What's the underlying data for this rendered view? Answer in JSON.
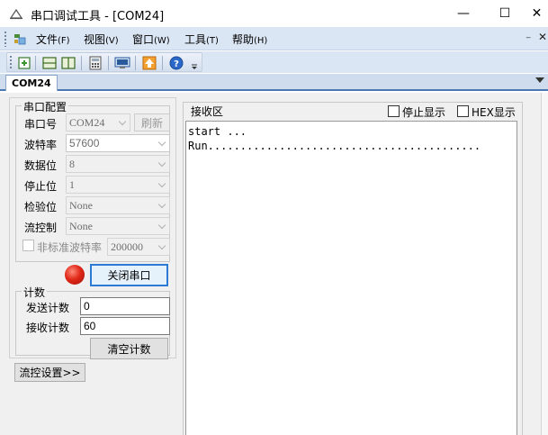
{
  "window": {
    "title": "串口调试工具 - [COM24]",
    "minimize_glyph": "—",
    "maximize_glyph": "☐",
    "close_glyph": "✕"
  },
  "menubar": {
    "items": [
      {
        "label": "文件",
        "accel": "(F)"
      },
      {
        "label": "视图",
        "accel": "(V)"
      },
      {
        "label": "窗口",
        "accel": "(W)"
      },
      {
        "label": "工具",
        "accel": "(T)"
      },
      {
        "label": "帮助",
        "accel": "(H)"
      }
    ],
    "mdi_min_glyph": "₋",
    "mdi_close_glyph": "✕"
  },
  "toolbar": {
    "icons": [
      "new-icon",
      "split-horizontal-icon",
      "split-vertical-icon",
      "calculator-icon",
      "terminal-icon",
      "upload-icon",
      "help-icon"
    ]
  },
  "tabs": [
    {
      "label": "COM24"
    }
  ],
  "serial_config": {
    "title": "串口配置",
    "port_label": "串口号",
    "port_value": "COM24",
    "refresh_label": "刷新",
    "baud_label": "波特率",
    "baud_value": "57600",
    "databits_label": "数据位",
    "databits_value": "8",
    "stopbits_label": "停止位",
    "stopbits_value": "1",
    "parity_label": "检验位",
    "parity_value": "None",
    "flow_label": "流控制",
    "flow_value": "None",
    "nonstd_label": "非标准波特率",
    "nonstd_value": "200000"
  },
  "port_action": {
    "close_label": "关闭串口",
    "status_color": "#e02818"
  },
  "counter": {
    "title": "计数",
    "send_label": "发送计数",
    "send_value": "0",
    "recv_label": "接收计数",
    "recv_value": "60",
    "clear_label": "清空计数"
  },
  "flow_settings_label": "流控设置>>",
  "receive": {
    "title": "接收区",
    "stop_display_label": "停止显示",
    "hex_display_label": "HEX显示",
    "text": "start ...\nRun.........................................."
  }
}
